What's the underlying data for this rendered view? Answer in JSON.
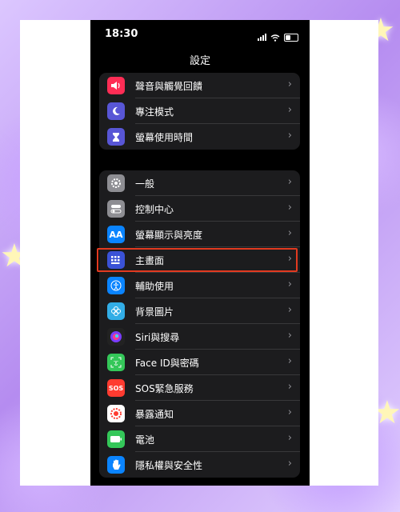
{
  "status_bar": {
    "time": "18:30"
  },
  "nav": {
    "title": "設定"
  },
  "group1": [
    {
      "label": "聲音與觸覺回饋",
      "icon": "speaker-icon",
      "color": "#ff2d55"
    },
    {
      "label": "專注模式",
      "icon": "moon-icon",
      "color": "#5856d6"
    },
    {
      "label": "螢幕使用時間",
      "icon": "hourglass-icon",
      "color": "#5856d6"
    }
  ],
  "group2": [
    {
      "label": "一般",
      "icon": "gear-icon",
      "color": "#8e8e93"
    },
    {
      "label": "控制中心",
      "icon": "toggles-icon",
      "color": "#8e8e93"
    },
    {
      "label": "螢幕顯示與亮度",
      "icon": "text-size-icon",
      "glyph": "AA",
      "color": "#0a84ff"
    },
    {
      "label": "主畫面",
      "icon": "home-screen-icon",
      "color": "#3a52d6"
    },
    {
      "label": "輔助使用",
      "icon": "accessibility-icon",
      "color": "#0a84ff"
    },
    {
      "label": "背景圖片",
      "icon": "wallpaper-icon",
      "color": "#32ade6"
    },
    {
      "label": "Siri與搜尋",
      "icon": "siri-icon",
      "color": "#222222"
    },
    {
      "label": "Face ID與密碼",
      "icon": "face-id-icon",
      "color": "#34c759"
    },
    {
      "label": "SOS緊急服務",
      "icon": "sos-icon",
      "glyph": "SOS",
      "color": "#ff3b30"
    },
    {
      "label": "暴露通知",
      "icon": "exposure-icon",
      "color": "#ffffff"
    },
    {
      "label": "電池",
      "icon": "battery-icon",
      "color": "#34c759"
    },
    {
      "label": "隱私權與安全性",
      "icon": "hand-icon",
      "color": "#0a84ff"
    }
  ],
  "highlighted_item": "主畫面"
}
